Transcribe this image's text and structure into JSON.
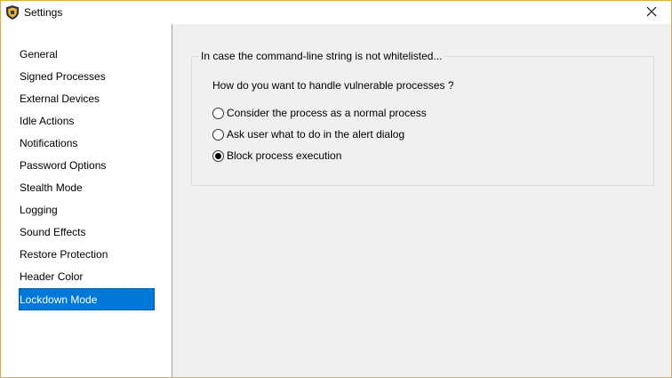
{
  "window": {
    "title": "Settings",
    "app_icon": "shield-icon",
    "close_icon": "close-icon",
    "border_color": "#e8a83a"
  },
  "sidebar": {
    "items": [
      {
        "label": "General",
        "selected": false
      },
      {
        "label": "Signed Processes",
        "selected": false
      },
      {
        "label": "External Devices",
        "selected": false
      },
      {
        "label": "Idle Actions",
        "selected": false
      },
      {
        "label": "Notifications",
        "selected": false
      },
      {
        "label": "Password Options",
        "selected": false
      },
      {
        "label": "Stealth Mode",
        "selected": false
      },
      {
        "label": "Logging",
        "selected": false
      },
      {
        "label": "Sound Effects",
        "selected": false
      },
      {
        "label": "Restore Protection",
        "selected": false
      },
      {
        "label": "Header Color",
        "selected": false
      },
      {
        "label": "Lockdown Mode",
        "selected": true
      }
    ],
    "selected_color": "#0078d7"
  },
  "main": {
    "group_title": "In case the command-line string is not whitelisted...",
    "question": "How do you want to handle vulnerable processes ?",
    "options": [
      {
        "label": "Consider the process as a normal process",
        "checked": false
      },
      {
        "label": "Ask user what to do in the alert dialog",
        "checked": false
      },
      {
        "label": "Block process execution",
        "checked": true
      }
    ]
  }
}
